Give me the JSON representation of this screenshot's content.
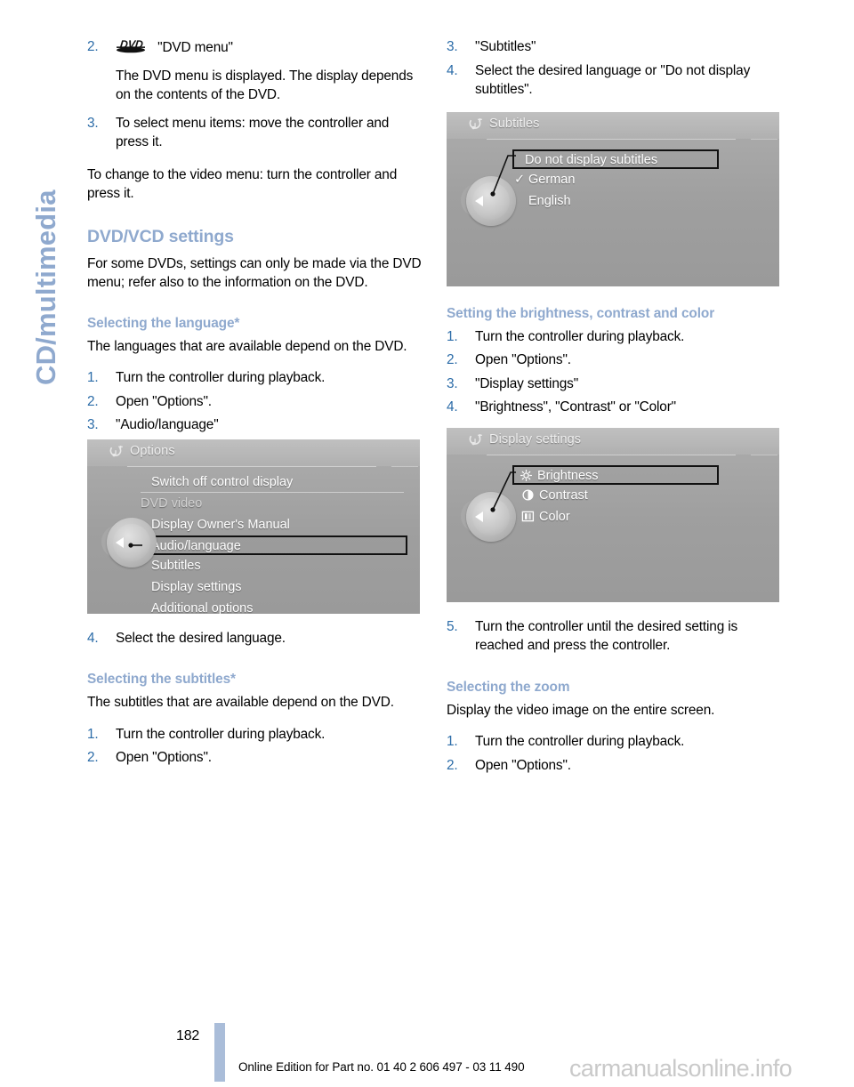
{
  "chapter": {
    "label": "CD/multimedia",
    "color": "#8fa9ce"
  },
  "left_column": {
    "step2": {
      "num": "2.",
      "icon": "dvd-logo",
      "text": "\"DVD menu\""
    },
    "step2_note": "The DVD menu is displayed. The display depends on the contents of the DVD.",
    "step3": {
      "num": "3.",
      "text": "To select menu items: move the controller and press it."
    },
    "paragraph_video_menu": "To change to the video menu: turn the controller and press it.",
    "heading_dvd_vcd": "DVD/VCD settings",
    "paragraph_dvd_vcd": "For some DVDs, settings can only be made via the DVD menu; refer also to the information on the DVD.",
    "subheading_language": "Selecting the language*",
    "paragraph_language": "The languages that are available depend on the DVD.",
    "language_steps": [
      {
        "num": "1.",
        "text": "Turn the controller during playback."
      },
      {
        "num": "2.",
        "text": "Open \"Options\"."
      },
      {
        "num": "3.",
        "text": "\"Audio/language\""
      }
    ],
    "step4_language": {
      "num": "4.",
      "text": "Select the desired language."
    },
    "subheading_subtitles": "Selecting the subtitles*",
    "paragraph_subtitles": "The subtitles that are available depend on the DVD.",
    "subtitle_steps": [
      {
        "num": "1.",
        "text": "Turn the controller during playback."
      },
      {
        "num": "2.",
        "text": "Open \"Options\"."
      }
    ]
  },
  "right_column": {
    "subtitle_steps_cont": [
      {
        "num": "3.",
        "text": "\"Subtitles\""
      },
      {
        "num": "4.",
        "text": "Select the desired language or \"Do not display subtitles\"."
      }
    ],
    "subheading_brightness": "Setting the brightness, contrast and color",
    "brightness_steps": [
      {
        "num": "1.",
        "text": "Turn the controller during playback."
      },
      {
        "num": "2.",
        "text": "Open \"Options\"."
      },
      {
        "num": "3.",
        "text": "\"Display settings\""
      },
      {
        "num": "4.",
        "text": "\"Brightness\", \"Contrast\" or \"Color\""
      }
    ],
    "step5_brightness": {
      "num": "5.",
      "text": "Turn the controller until the desired setting is reached and press the controller."
    },
    "subheading_zoom": "Selecting the zoom",
    "paragraph_zoom": "Display the video image on the entire screen.",
    "zoom_steps": [
      {
        "num": "1.",
        "text": "Turn the controller during playback."
      },
      {
        "num": "2.",
        "text": "Open \"Options\"."
      }
    ]
  },
  "screens": {
    "options": {
      "title": "Options",
      "title_icon": "idrive-options-icon",
      "items": [
        {
          "label": "Switch off control display",
          "style": "rule-under",
          "selected": false
        },
        {
          "label": "DVD video",
          "style": "dim",
          "selected": false
        },
        {
          "label": "Display Owner's Manual",
          "style": "",
          "selected": false
        },
        {
          "label": "Audio/language",
          "style": "",
          "selected": true
        },
        {
          "label": "Subtitles",
          "style": "",
          "selected": false
        },
        {
          "label": "Display settings",
          "style": "",
          "selected": false
        },
        {
          "label": "Additional options",
          "style": "",
          "selected": false
        }
      ]
    },
    "subtitles": {
      "title": "Subtitles",
      "title_icon": "idrive-options-icon",
      "items": [
        {
          "label": "Do not display subtitles",
          "check": false,
          "selected": true
        },
        {
          "label": "German",
          "check": true,
          "selected": false
        },
        {
          "label": "English",
          "check": false,
          "selected": false
        }
      ]
    },
    "display_settings": {
      "title": "Display settings",
      "title_icon": "idrive-options-icon",
      "items": [
        {
          "label": "Brightness",
          "icon": "brightness-icon",
          "selected": true
        },
        {
          "label": "Contrast",
          "icon": "contrast-icon",
          "selected": false
        },
        {
          "label": "Color",
          "icon": "color-icon",
          "selected": false
        }
      ]
    }
  },
  "footer": {
    "page_number": "182",
    "note": "Online Edition for Part no. 01 40 2 606 497 - 03 11 490",
    "watermark": "carmanualsonline.info"
  }
}
